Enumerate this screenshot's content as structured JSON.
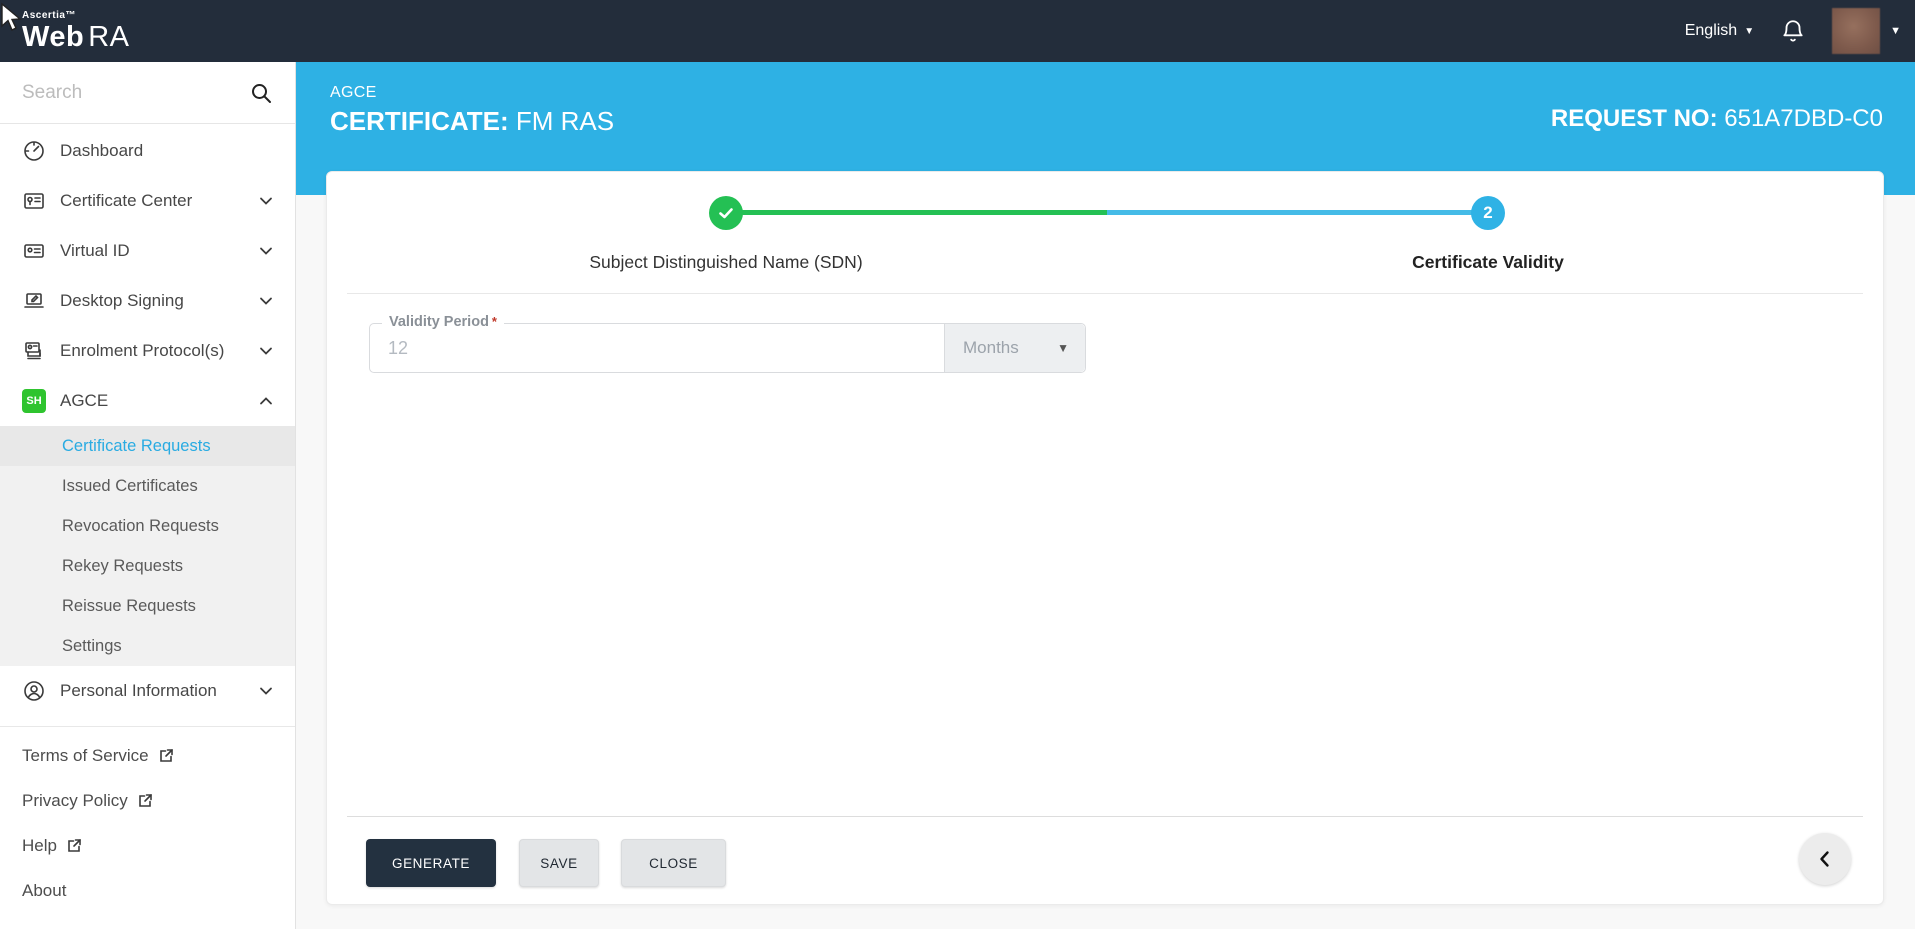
{
  "topbar": {
    "brand_top": "Ascertia™",
    "brand_main_1": "Web",
    "brand_main_2": "RA",
    "language_label": "English",
    "language_caret": "▼",
    "avatar_caret": "▼",
    "icons": [
      "notification-bell-icon",
      "user-avatar"
    ]
  },
  "sidebar": {
    "search_placeholder": "Search",
    "items": [
      {
        "label": "Dashboard",
        "icon": "dashboard-icon"
      },
      {
        "label": "Certificate Center",
        "icon": "certificate-center-icon",
        "chevron": "down"
      },
      {
        "label": "Virtual ID",
        "icon": "virtual-id-icon",
        "chevron": "down"
      },
      {
        "label": "Desktop Signing",
        "icon": "desktop-signing-icon",
        "chevron": "down"
      },
      {
        "label": "Enrolment Protocol(s)",
        "icon": "enrolment-protocols-icon",
        "chevron": "down"
      },
      {
        "label": "AGCE",
        "icon": "agce-sh-badge",
        "badge_text": "SH",
        "chevron": "up",
        "expanded": true
      }
    ],
    "agce_submenu": [
      {
        "label": "Certificate Requests",
        "active": true
      },
      {
        "label": "Issued Certificates"
      },
      {
        "label": "Revocation Requests"
      },
      {
        "label": "Rekey Requests"
      },
      {
        "label": "Reissue Requests"
      },
      {
        "label": "Settings"
      }
    ],
    "personal_info_label": "Personal Information",
    "footer_links": [
      {
        "label": "Terms of Service",
        "external": true
      },
      {
        "label": "Privacy Policy",
        "external": true
      },
      {
        "label": "Help",
        "external": true
      },
      {
        "label": "About",
        "external": false
      }
    ]
  },
  "header": {
    "app_label": "AGCE",
    "title_bold": "CERTIFICATE:",
    "title_value": " FM RAS",
    "request_label": "REQUEST NO:",
    "request_value": " 651A7DBD-C0"
  },
  "stepper": {
    "steps": [
      {
        "label": "Subject Distinguished Name (SDN)",
        "state": "complete",
        "icon": "check-icon"
      },
      {
        "label": "Certificate Validity",
        "state": "active",
        "number": "2"
      }
    ]
  },
  "form": {
    "validity_label": "Validity Period",
    "required_marker": "*",
    "validity_value": "12",
    "unit_value": "Months",
    "unit_caret": "▼"
  },
  "actions": {
    "generate_label": "GENERATE",
    "save_label": "SAVE",
    "close_label": "CLOSE"
  },
  "colors": {
    "topbar_bg": "#232d3b",
    "accent_blue": "#29abe2",
    "band_blue": "#2eb1e4",
    "progress_green": "#24c054",
    "badge_green": "#2fc42f",
    "primary_button_navy": "#233140",
    "submenu_bg": "#f1f1f1"
  }
}
